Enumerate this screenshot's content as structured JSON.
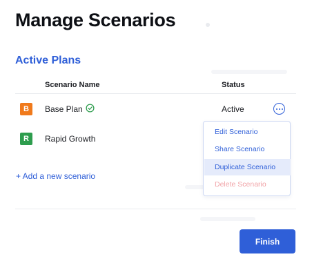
{
  "page": {
    "title": "Manage Scenarios",
    "section_title": "Active Plans"
  },
  "table": {
    "columns": [
      "Scenario Name",
      "Status"
    ],
    "rows": [
      {
        "badge": "B",
        "badge_color": "#f07a1c",
        "name": "Base Plan",
        "status": "Active",
        "verified": true
      },
      {
        "badge": "R",
        "badge_color": "#2e9d4e",
        "name": "Rapid Growth",
        "status": ""
      }
    ]
  },
  "actions": {
    "add_scenario": "+ Add a new scenario",
    "finish": "Finish"
  },
  "row_menu": {
    "items": [
      "Edit Scenario",
      "Share Scenario",
      "Duplicate Scenario",
      "Delete Scenario"
    ],
    "highlighted": "Duplicate Scenario",
    "disabled": "Delete Scenario"
  },
  "colors": {
    "accent": "#2f5fd8",
    "menu_highlight": "#e5ebfb",
    "danger_muted": "#f1a3a7",
    "verified": "#2e9d4e"
  },
  "icons": [
    "check-circle-icon",
    "more-horizontal-icon"
  ]
}
